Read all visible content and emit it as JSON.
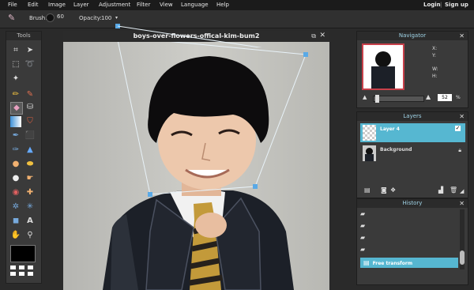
{
  "menu": {
    "items": [
      "File",
      "Edit",
      "Image",
      "Layer",
      "Adjustment",
      "Filter",
      "View",
      "Language",
      "Help"
    ],
    "login": "Login",
    "signup": "Sign up"
  },
  "options": {
    "brush_label": "Brush:",
    "brush_size": "60",
    "opacity_label": "Opacity:",
    "opacity_value": "100"
  },
  "tools": {
    "title": "Tools"
  },
  "document": {
    "title": "boys-over-flowers-offical-kim-bum2"
  },
  "navigator": {
    "title": "Navigator",
    "x_label": "X:",
    "y_label": "Y:",
    "w_label": "W:",
    "h_label": "H:",
    "zoom": "52",
    "zoom_unit": "%"
  },
  "layers": {
    "title": "Layers",
    "items": [
      {
        "name": "Layer 4"
      },
      {
        "name": "Background"
      }
    ]
  },
  "history": {
    "title": "History",
    "items": [
      "Free transform"
    ]
  },
  "colors": {
    "accent": "#56b7d1",
    "menubar": "#1b1b1b",
    "panel": "#3a3a3a"
  }
}
